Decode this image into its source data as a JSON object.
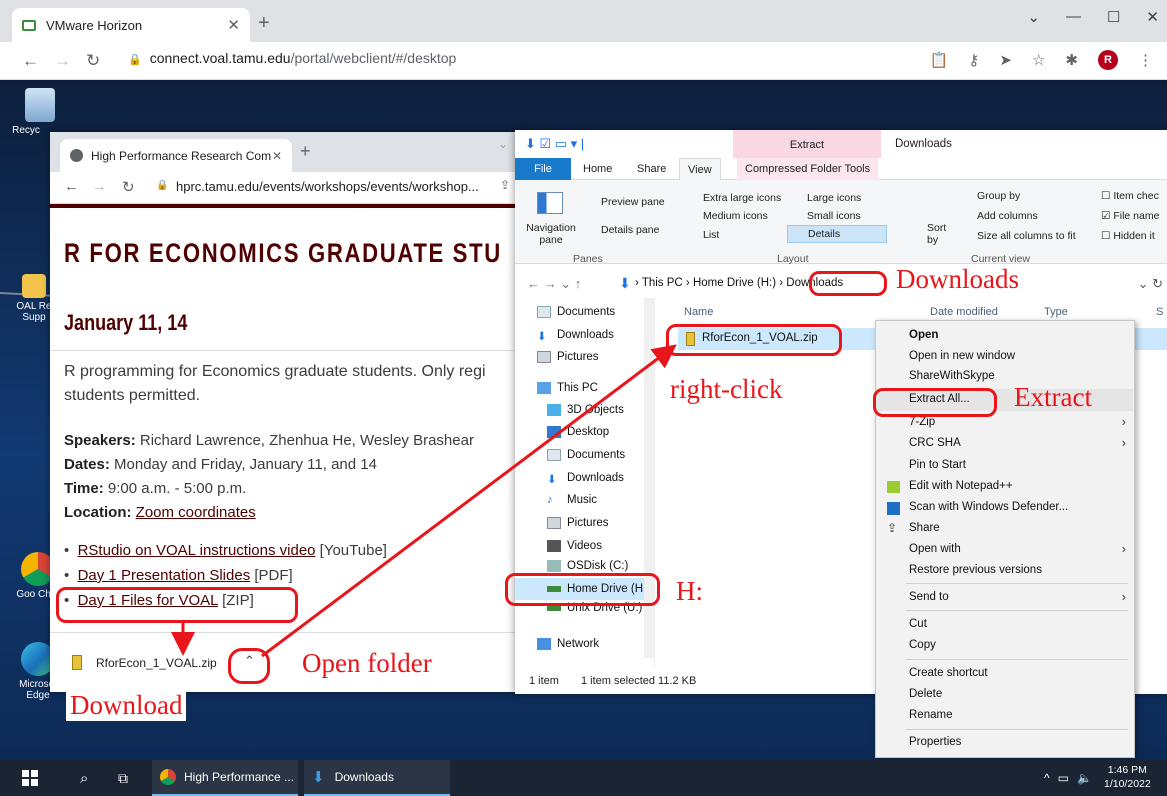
{
  "outer_browser": {
    "tab_title": "VMware Horizon",
    "url_host": "connect.voal.tamu.edu",
    "url_path": "/portal/webclient/#/desktop"
  },
  "desktop": {
    "icons": [
      {
        "label": "Recyc"
      },
      {
        "label": "OAL Re Supp"
      },
      {
        "label": "Goo Chro"
      },
      {
        "label": "Microsof Edge"
      }
    ]
  },
  "inner_browser": {
    "tab_title": "High Performance Research Com",
    "url": "hprc.tamu.edu/events/workshops/events/workshop...",
    "heading": "R FOR ECONOMICS GRADUATE STU",
    "dates_heading": "January 11, 14",
    "description": "R programming for Economics graduate students. Only regi students permitted.",
    "speakers_label": "Speakers:",
    "speakers_value": "Richard Lawrence, Zhenhua He, Wesley Brashear",
    "dates_label": "Dates:",
    "dates_value": "Monday and Friday, January 11, and 14",
    "time_label": "Time:",
    "time_value": "9:00 a.m. - 5:00 p.m.",
    "location_label": "Location:",
    "location_value": "Zoom coordinates",
    "links": [
      {
        "text": "RStudio on VOAL instructions video",
        "suffix": "[YouTube]"
      },
      {
        "text": "Day 1 Presentation Slides",
        "suffix": "[PDF]"
      },
      {
        "text": "Day 1 Files for VOAL",
        "suffix": "[ZIP]"
      }
    ],
    "download_file": "RforEcon_1_VOAL.zip"
  },
  "explorer": {
    "title": "Downloads",
    "extract_tab_top": "Extract",
    "tabs": [
      "File",
      "Home",
      "Share",
      "View",
      "Compressed Folder Tools"
    ],
    "ribbon": {
      "preview_pane": "Preview pane",
      "details_pane": "Details pane",
      "navigation_pane": "Navigation pane",
      "extra_large_icons": "Extra large icons",
      "large_icons": "Large icons",
      "medium_icons": "Medium icons",
      "small_icons": "Small icons",
      "list": "List",
      "details": "Details",
      "sort_by": "Sort by",
      "group_by": "Group by",
      "add_columns": "Add columns",
      "size_all_columns": "Size all columns to fit",
      "item_check": "Item chec",
      "file_name_ext": "File name",
      "hidden_items": "Hidden it",
      "group_panes": "Panes",
      "group_layout": "Layout",
      "group_current_view": "Current view"
    },
    "breadcrumb": [
      "This PC",
      "Home Drive (H:)",
      "Downloads"
    ],
    "columns": {
      "name": "Name",
      "date": "Date modified",
      "type": "Type",
      "size": "S"
    },
    "nav": [
      "Documents",
      "Downloads",
      "Pictures",
      "This PC",
      "3D Objects",
      "Desktop",
      "Documents",
      "Downloads",
      "Music",
      "Pictures",
      "Videos",
      "OSDisk (C:)",
      "Home Drive (H:)",
      "Unix Drive (U:)",
      "Network"
    ],
    "file": "RforEcon_1_VOAL.zip",
    "status_items": "1 item",
    "status_selected": "1 item selected  11.2 KB"
  },
  "context_menu": {
    "items": [
      "Open",
      "Open in new window",
      "ShareWithSkype",
      "Extract All...",
      "7-Zip",
      "CRC SHA",
      "Pin to Start",
      "Edit with Notepad++",
      "Scan with Windows Defender...",
      "Share",
      "Open with",
      "Restore previous versions",
      "Send to",
      "Cut",
      "Copy",
      "Create shortcut",
      "Delete",
      "Rename",
      "Properties"
    ]
  },
  "annotations": {
    "downloads": "Downloads",
    "right_click": "right-click",
    "extract": "Extract",
    "h_drive": "H:",
    "open_folder": "Open  folder",
    "download": "Download"
  },
  "taskbar": {
    "app1": "High Performance ...",
    "app2": "Downloads",
    "time": "1:46 PM",
    "date": "1/10/2022"
  },
  "colors": {
    "annotation_red": "#e8151a",
    "tamu_maroon": "#500000"
  }
}
